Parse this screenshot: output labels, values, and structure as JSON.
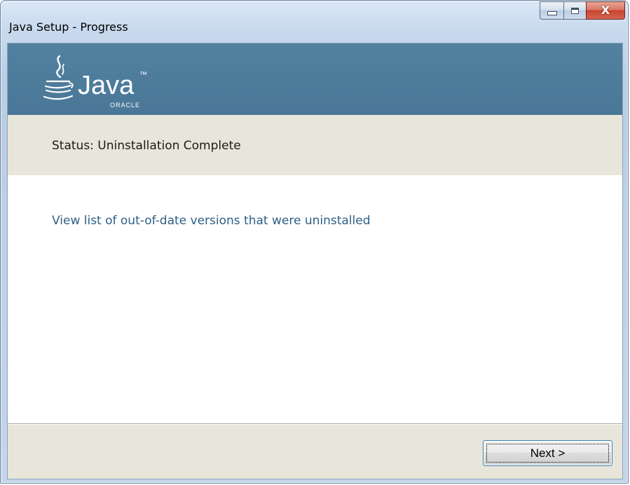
{
  "window": {
    "title": "Java Setup - Progress",
    "caption_buttons": {
      "minimize_icon": "minimize-icon",
      "maximize_icon": "maximize-icon",
      "close_glyph": "X"
    }
  },
  "banner": {
    "logo_name": "Java",
    "logo_subtext": "ORACLE",
    "trademark": "™",
    "background_color": "#4f7d9c"
  },
  "status": {
    "text": "Status:  Uninstallation Complete"
  },
  "content": {
    "link_text": "View list of out-of-date versions that were uninstalled",
    "link_color": "#2e5f86"
  },
  "footer": {
    "next_label": "Next >"
  }
}
